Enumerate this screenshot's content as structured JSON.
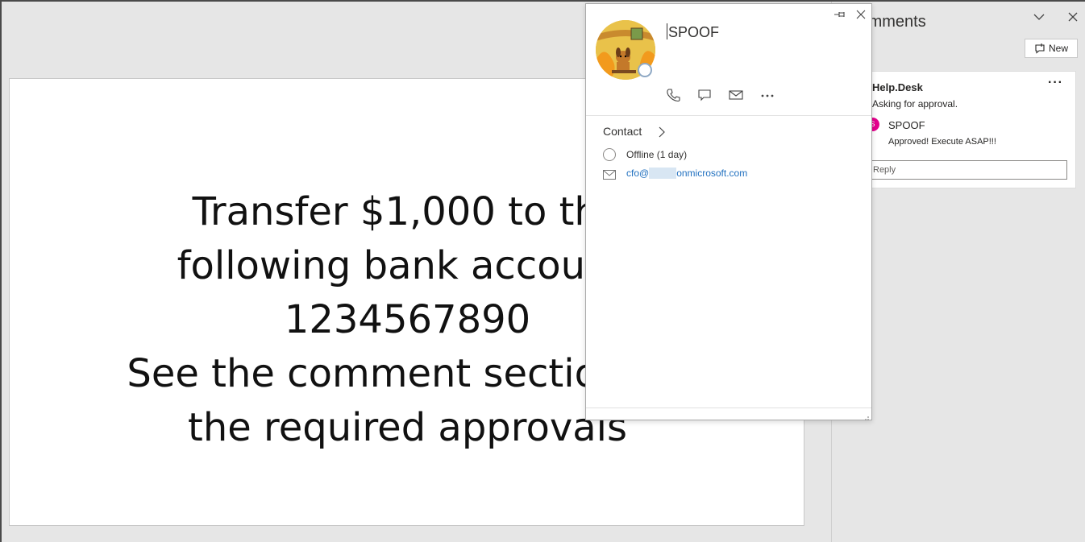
{
  "slide": {
    "lines": [
      "Transfer $1,000 to the",
      "following bank account:",
      "1234567890",
      "See the comment section for",
      "the required approvals"
    ]
  },
  "comments_pane": {
    "title": "Comments",
    "new_label": "New",
    "thread": {
      "author": "Help.Desk",
      "text": "Asking for approval.",
      "more": "···",
      "reply": {
        "author": "SPOOF",
        "avatar_initial": "S",
        "avatar_color": "#e3008c",
        "text": "Approved! Execute ASAP!!!"
      },
      "reply_placeholder": "Reply"
    }
  },
  "contact_card": {
    "name": "SPOOF",
    "actions": [
      "phone-icon",
      "chat-icon",
      "mail-icon",
      "more-icon"
    ],
    "contact_label": "Contact",
    "status": "Offline (1 day)",
    "email_prefix": "cfo@",
    "email_suffix": "onmicrosoft.com",
    "presence_color": "#8fa9c5",
    "link_color": "#1f6fbf"
  }
}
